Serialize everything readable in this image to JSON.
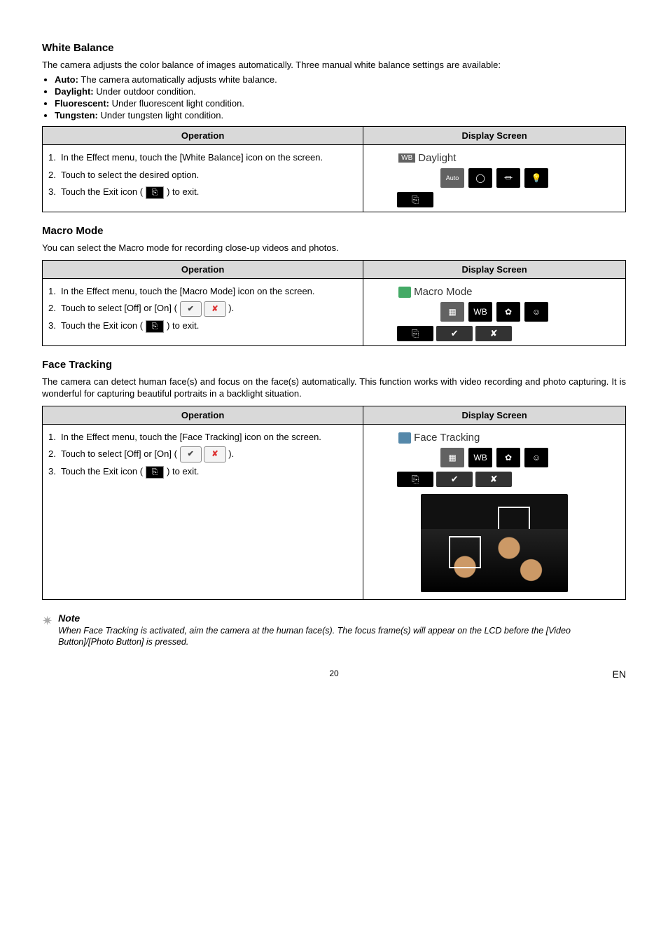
{
  "sections": {
    "whiteBalance": {
      "heading": "White Balance",
      "intro": "The camera adjusts the color balance of images automatically. Three manual white balance settings are available:",
      "bullets": [
        {
          "strong": "Auto:",
          "rest": " The camera automatically adjusts white balance."
        },
        {
          "strong": "Daylight:",
          "rest": " Under outdoor condition."
        },
        {
          "strong": "Fluorescent:",
          "rest": " Under fluorescent light condition."
        },
        {
          "strong": "Tungsten:",
          "rest": " Under tungsten light condition."
        }
      ],
      "opHeader": "Operation",
      "dispHeader": "Display Screen",
      "steps": [
        "In the Effect menu, touch the [White Balance] icon on the screen.",
        "Touch to select the desired option.",
        "Touch the Exit icon (    ) to exit."
      ],
      "screenTitle": "Daylight",
      "iconAuto": "Auto"
    },
    "macroMode": {
      "heading": "Macro Mode",
      "intro": "You can select the Macro mode for recording close-up videos and photos.",
      "opHeader": "Operation",
      "dispHeader": "Display Screen",
      "steps": [
        "In the Effect menu, touch the [Macro Mode] icon on the screen.",
        "Touch to select [Off] or [On] (          ).",
        "Touch the Exit icon (    ) to exit."
      ],
      "screenTitle": "Macro Mode",
      "wbLabel": "WB"
    },
    "faceTracking": {
      "heading": "Face Tracking",
      "intro": "The camera can detect human face(s) and focus on the face(s) automatically. This function works with video recording and photo capturing. It is wonderful for capturing beautiful portraits in a backlight situation.",
      "opHeader": "Operation",
      "dispHeader": "Display Screen",
      "steps": [
        "In the Effect menu, touch the [Face Tracking] icon on the screen.",
        "Touch to select [Off] or [On] (          ).",
        "Touch the Exit icon (    ) to exit."
      ],
      "screenTitle": "Face Tracking",
      "wbLabel": "WB"
    }
  },
  "note": {
    "title": "Note",
    "body": "When Face Tracking is activated, aim the camera at the human face(s). The focus frame(s) will appear on the LCD before the [Video Button]/[Photo Button] is pressed."
  },
  "footer": {
    "page": "20",
    "lang": "EN"
  }
}
